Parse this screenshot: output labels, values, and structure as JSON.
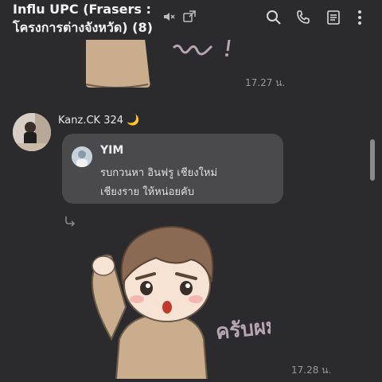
{
  "header": {
    "title_line1": "Influ UPC (Frasers :",
    "title_line2": "โครงการต่างจังหวัด) (8)",
    "icons": [
      "mute-icon",
      "popout-icon",
      "search-icon",
      "phone-icon",
      "notes-icon",
      "more-icon"
    ]
  },
  "messages": {
    "sticker_top_time": "17.27 น.",
    "sender_name": "Kanz.CK 324",
    "sender_emoji": "🌙",
    "reply": {
      "name": "YIM",
      "line1": "รบกวนหา อินฟรู เชียงใหม่",
      "line2": "เชียงราย ให้หน่อยคับ"
    },
    "sticker_text": "ครับผม!",
    "sticker_time": "17.28 น."
  },
  "colors": {
    "background": "#2b2b2d",
    "bubble": "#4a4a4c",
    "sticker_skin": "#f7e3d3",
    "sticker_hair": "#8a6a52",
    "sticker_shirt": "#c9ad8c",
    "sticker_text": "#b7a6b0"
  }
}
